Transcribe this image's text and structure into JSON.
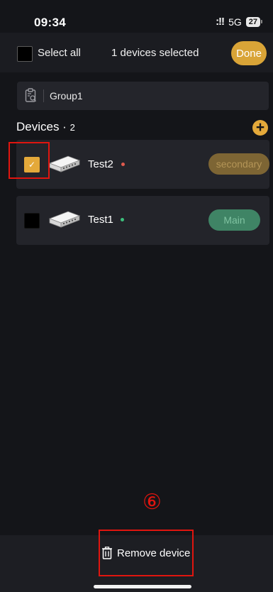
{
  "status_bar": {
    "time": "09:34",
    "signal": ":!!",
    "network": "5G",
    "battery": "27"
  },
  "header": {
    "select_all_label": "Select all",
    "selected_count": "1 devices selected",
    "done_label": "Done"
  },
  "group": {
    "value": "Group1"
  },
  "devices": {
    "title": "Devices · ",
    "count": "2",
    "items": [
      {
        "name": "Test2",
        "role": "secondary",
        "checked": true,
        "status_color": "#e05a4e"
      },
      {
        "name": "Test1",
        "role": "Main",
        "checked": false,
        "status_color": "#3cbf7c"
      }
    ]
  },
  "annotation": {
    "step": "⑥"
  },
  "footer": {
    "remove_label": "Remove device"
  },
  "colors": {
    "accent": "#e4a93a",
    "highlight": "#e0150f",
    "background": "#141519"
  }
}
